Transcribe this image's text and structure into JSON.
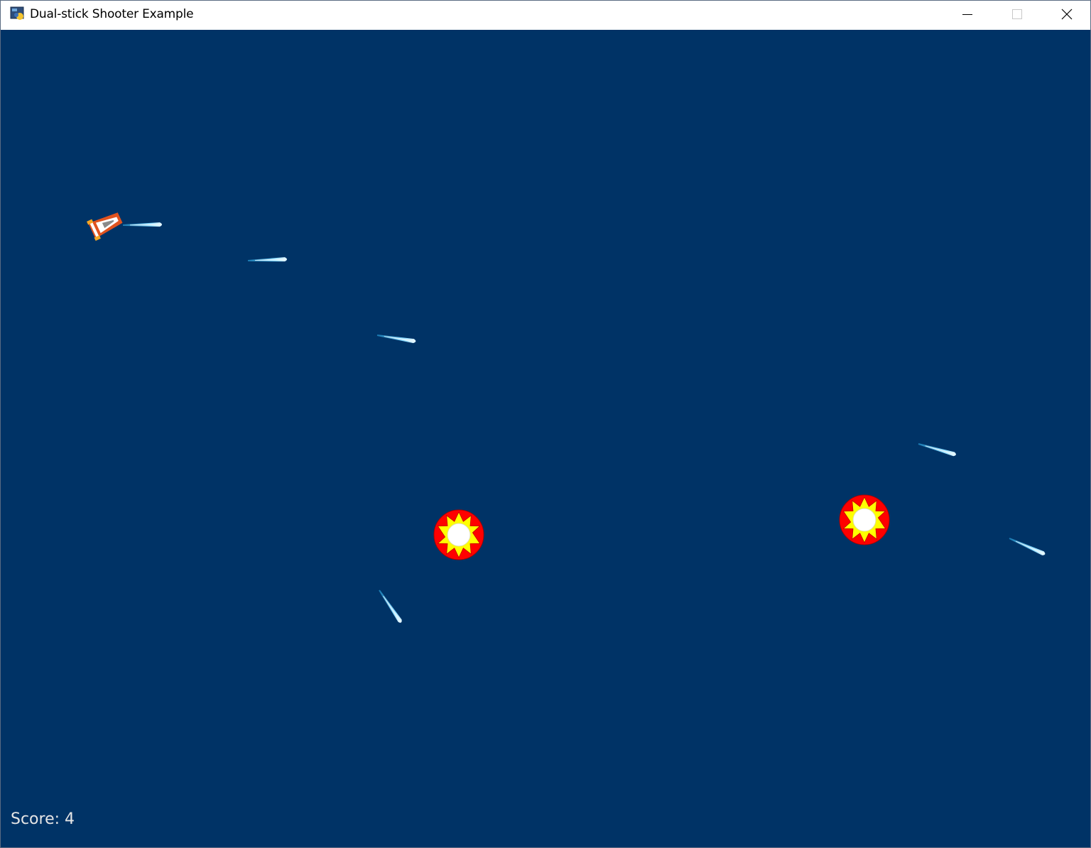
{
  "window": {
    "title": "Dual-stick Shooter Example",
    "app_icon": "python-icon",
    "controls": {
      "minimize_icon": "minimize-icon",
      "maximize_icon": "maximize-icon",
      "close_icon": "close-icon"
    }
  },
  "game": {
    "background_color": "#003366",
    "score_text": "Score: 4",
    "player": {
      "icon": "spaceship-icon",
      "colors": [
        "#ffffff",
        "#e0531f",
        "#f5a623"
      ]
    },
    "enemy": {
      "icon": "sun-burst-enemy-icon",
      "colors": [
        "#ff0000",
        "#ffff00",
        "#ffffff"
      ]
    },
    "bullet": {
      "icon": "laser-bullet-icon",
      "color": "#4fc8f0"
    }
  }
}
